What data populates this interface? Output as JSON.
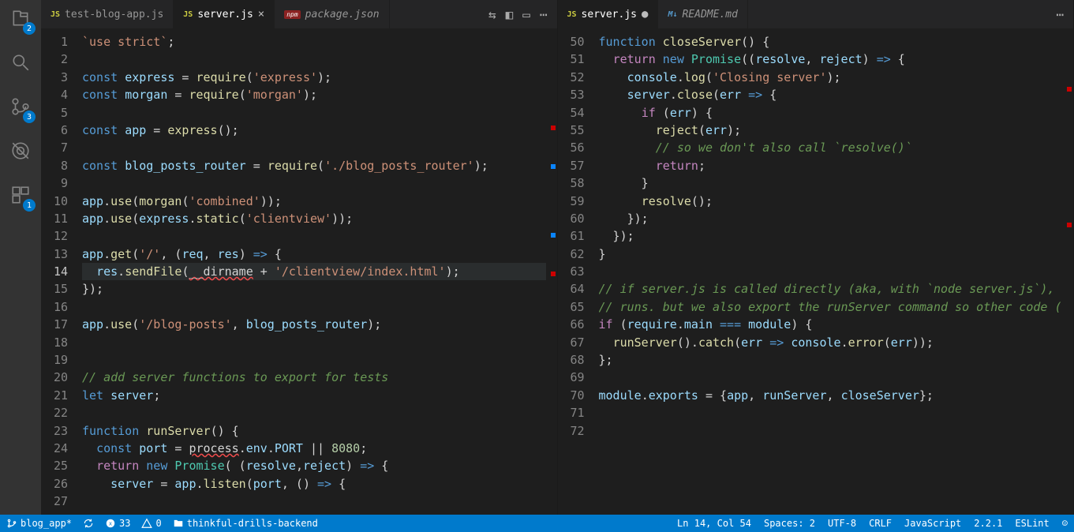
{
  "activity_badges": {
    "explorer": "2",
    "scm": "3",
    "other": "1"
  },
  "left": {
    "tabs": [
      {
        "label": "test-blog-app.js",
        "type": "js",
        "active": false
      },
      {
        "label": "server.js",
        "type": "js",
        "active": true,
        "close": "×"
      },
      {
        "label": "package.json",
        "type": "npm",
        "active": false,
        "italic": true
      }
    ],
    "lines": [
      [
        1,
        [
          [
            "str",
            "`use strict`"
          ],
          [
            "punc",
            ";"
          ]
        ]
      ],
      [
        2,
        []
      ],
      [
        3,
        [
          [
            "kw2",
            "const"
          ],
          [
            "punc",
            " "
          ],
          [
            "var",
            "express"
          ],
          [
            "punc",
            " = "
          ],
          [
            "fn",
            "require"
          ],
          [
            "punc",
            "("
          ],
          [
            "str",
            "'express'"
          ],
          [
            "punc",
            ");"
          ]
        ]
      ],
      [
        4,
        [
          [
            "kw2",
            "const"
          ],
          [
            "punc",
            " "
          ],
          [
            "var",
            "morgan"
          ],
          [
            "punc",
            " = "
          ],
          [
            "fn",
            "require"
          ],
          [
            "punc",
            "("
          ],
          [
            "str",
            "'morgan'"
          ],
          [
            "punc",
            ");"
          ]
        ]
      ],
      [
        5,
        []
      ],
      [
        6,
        [
          [
            "kw2",
            "const"
          ],
          [
            "punc",
            " "
          ],
          [
            "var",
            "app"
          ],
          [
            "punc",
            " = "
          ],
          [
            "fn",
            "express"
          ],
          [
            "punc",
            "();"
          ]
        ]
      ],
      [
        7,
        []
      ],
      [
        8,
        [
          [
            "kw2",
            "const"
          ],
          [
            "punc",
            " "
          ],
          [
            "var",
            "blog_posts_router"
          ],
          [
            "punc",
            " = "
          ],
          [
            "fn",
            "require"
          ],
          [
            "punc",
            "("
          ],
          [
            "str",
            "'./blog_posts_router'"
          ],
          [
            "punc",
            ");"
          ]
        ]
      ],
      [
        9,
        []
      ],
      [
        10,
        [
          [
            "var",
            "app"
          ],
          [
            "punc",
            "."
          ],
          [
            "fn",
            "use"
          ],
          [
            "punc",
            "("
          ],
          [
            "fn",
            "morgan"
          ],
          [
            "punc",
            "("
          ],
          [
            "str",
            "'combined'"
          ],
          [
            "punc",
            "));"
          ]
        ]
      ],
      [
        11,
        [
          [
            "var",
            "app"
          ],
          [
            "punc",
            "."
          ],
          [
            "fn",
            "use"
          ],
          [
            "punc",
            "("
          ],
          [
            "var",
            "express"
          ],
          [
            "punc",
            "."
          ],
          [
            "fn",
            "static"
          ],
          [
            "punc",
            "("
          ],
          [
            "str",
            "'clientview'"
          ],
          [
            "punc",
            "));"
          ]
        ]
      ],
      [
        12,
        []
      ],
      [
        13,
        [
          [
            "var",
            "app"
          ],
          [
            "punc",
            "."
          ],
          [
            "fn",
            "get"
          ],
          [
            "punc",
            "("
          ],
          [
            "str",
            "'/'"
          ],
          [
            "punc",
            ", ("
          ],
          [
            "var",
            "req"
          ],
          [
            "punc",
            ", "
          ],
          [
            "var",
            "res"
          ],
          [
            "punc",
            ") "
          ],
          [
            "kw2",
            "=>"
          ],
          [
            "punc",
            " {"
          ]
        ]
      ],
      [
        14,
        [
          [
            "punc",
            "  "
          ],
          [
            "var",
            "res"
          ],
          [
            "punc",
            "."
          ],
          [
            "fn",
            "sendFile"
          ],
          [
            "punc",
            "("
          ],
          [
            "err",
            "__dirname"
          ],
          [
            "punc",
            " + "
          ],
          [
            "str",
            "'/clientview/index.html'"
          ],
          [
            "punc",
            ");"
          ]
        ],
        "current"
      ],
      [
        15,
        [
          [
            "punc",
            "});"
          ]
        ]
      ],
      [
        16,
        []
      ],
      [
        17,
        [
          [
            "var",
            "app"
          ],
          [
            "punc",
            "."
          ],
          [
            "fn",
            "use"
          ],
          [
            "punc",
            "("
          ],
          [
            "str",
            "'/blog-posts'"
          ],
          [
            "punc",
            ", "
          ],
          [
            "var",
            "blog_posts_router"
          ],
          [
            "punc",
            ");"
          ]
        ]
      ],
      [
        18,
        []
      ],
      [
        19,
        []
      ],
      [
        20,
        [
          [
            "cmt",
            "// add server functions to export for tests"
          ]
        ]
      ],
      [
        21,
        [
          [
            "kw2",
            "let"
          ],
          [
            "punc",
            " "
          ],
          [
            "var",
            "server"
          ],
          [
            "punc",
            ";"
          ]
        ]
      ],
      [
        22,
        []
      ],
      [
        23,
        [
          [
            "kw2",
            "function"
          ],
          [
            "punc",
            " "
          ],
          [
            "fn",
            "runServer"
          ],
          [
            "punc",
            "() {"
          ]
        ]
      ],
      [
        24,
        [
          [
            "punc",
            "  "
          ],
          [
            "kw2",
            "const"
          ],
          [
            "punc",
            " "
          ],
          [
            "var",
            "port"
          ],
          [
            "punc",
            " = "
          ],
          [
            "err",
            "process"
          ],
          [
            "punc",
            "."
          ],
          [
            "var",
            "env"
          ],
          [
            "punc",
            "."
          ],
          [
            "var",
            "PORT"
          ],
          [
            "punc",
            " || "
          ],
          [
            "num",
            "8080"
          ],
          [
            "punc",
            ";"
          ]
        ]
      ],
      [
        25,
        [
          [
            "punc",
            "  "
          ],
          [
            "kw",
            "return"
          ],
          [
            "punc",
            " "
          ],
          [
            "kw2",
            "new"
          ],
          [
            "punc",
            " "
          ],
          [
            "type",
            "Promise"
          ],
          [
            "punc",
            "( ("
          ],
          [
            "var",
            "resolve"
          ],
          [
            "punc",
            ","
          ],
          [
            "var",
            "reject"
          ],
          [
            "punc",
            ") "
          ],
          [
            "kw2",
            "=>"
          ],
          [
            "punc",
            " {"
          ]
        ]
      ],
      [
        26,
        [
          [
            "punc",
            "    "
          ],
          [
            "var",
            "server"
          ],
          [
            "punc",
            " = "
          ],
          [
            "var",
            "app"
          ],
          [
            "punc",
            "."
          ],
          [
            "fn",
            "listen"
          ],
          [
            "punc",
            "("
          ],
          [
            "var",
            "port"
          ],
          [
            "punc",
            ", () "
          ],
          [
            "kw2",
            "=>"
          ],
          [
            "punc",
            " {"
          ]
        ]
      ],
      [
        27,
        []
      ]
    ]
  },
  "right": {
    "tabs": [
      {
        "label": "server.js",
        "type": "js",
        "active": true,
        "dirty": "●"
      },
      {
        "label": "README.md",
        "type": "md",
        "active": false,
        "italic": true
      }
    ],
    "lines": [
      [
        50,
        [
          [
            "kw2",
            "function"
          ],
          [
            "punc",
            " "
          ],
          [
            "fn",
            "closeServer"
          ],
          [
            "punc",
            "() {"
          ]
        ]
      ],
      [
        51,
        [
          [
            "punc",
            "  "
          ],
          [
            "kw",
            "return"
          ],
          [
            "punc",
            " "
          ],
          [
            "kw2",
            "new"
          ],
          [
            "punc",
            " "
          ],
          [
            "type",
            "Promise"
          ],
          [
            "punc",
            "(("
          ],
          [
            "var",
            "resolve"
          ],
          [
            "punc",
            ", "
          ],
          [
            "var",
            "reject"
          ],
          [
            "punc",
            ") "
          ],
          [
            "kw2",
            "=>"
          ],
          [
            "punc",
            " {"
          ]
        ]
      ],
      [
        52,
        [
          [
            "punc",
            "    "
          ],
          [
            "var",
            "console"
          ],
          [
            "punc",
            "."
          ],
          [
            "fn",
            "log"
          ],
          [
            "punc",
            "("
          ],
          [
            "str",
            "'Closing server'"
          ],
          [
            "punc",
            ");"
          ]
        ]
      ],
      [
        53,
        [
          [
            "punc",
            "    "
          ],
          [
            "var",
            "server"
          ],
          [
            "punc",
            "."
          ],
          [
            "fn",
            "close"
          ],
          [
            "punc",
            "("
          ],
          [
            "var",
            "err"
          ],
          [
            "punc",
            " "
          ],
          [
            "kw2",
            "=>"
          ],
          [
            "punc",
            " {"
          ]
        ]
      ],
      [
        54,
        [
          [
            "punc",
            "      "
          ],
          [
            "kw",
            "if"
          ],
          [
            "punc",
            " ("
          ],
          [
            "var",
            "err"
          ],
          [
            "punc",
            ") {"
          ]
        ]
      ],
      [
        55,
        [
          [
            "punc",
            "        "
          ],
          [
            "fn",
            "reject"
          ],
          [
            "punc",
            "("
          ],
          [
            "var",
            "err"
          ],
          [
            "punc",
            ");"
          ]
        ]
      ],
      [
        56,
        [
          [
            "punc",
            "        "
          ],
          [
            "cmt",
            "// so we don't also call `resolve()`"
          ]
        ]
      ],
      [
        57,
        [
          [
            "punc",
            "        "
          ],
          [
            "kw",
            "return"
          ],
          [
            "punc",
            ";"
          ]
        ]
      ],
      [
        58,
        [
          [
            "punc",
            "      }"
          ]
        ]
      ],
      [
        59,
        [
          [
            "punc",
            "      "
          ],
          [
            "fn",
            "resolve"
          ],
          [
            "punc",
            "();"
          ]
        ]
      ],
      [
        60,
        [
          [
            "punc",
            "    });"
          ]
        ]
      ],
      [
        61,
        [
          [
            "punc",
            "  });"
          ]
        ]
      ],
      [
        62,
        [
          [
            "punc",
            "}"
          ]
        ]
      ],
      [
        63,
        []
      ],
      [
        64,
        [
          [
            "cmt",
            "// if server.js is called directly (aka, with `node server.js`), this block"
          ]
        ]
      ],
      [
        65,
        [
          [
            "cmt",
            "// runs. but we also export the runServer command so other code (for instance, test code) can start the server as needed."
          ]
        ]
      ],
      [
        66,
        [
          [
            "kw",
            "if"
          ],
          [
            "punc",
            " ("
          ],
          [
            "var",
            "require"
          ],
          [
            "punc",
            "."
          ],
          [
            "var",
            "main"
          ],
          [
            "punc",
            " "
          ],
          [
            "kw2",
            "==="
          ],
          [
            "punc",
            " "
          ],
          [
            "var",
            "module"
          ],
          [
            "punc",
            ") {"
          ]
        ]
      ],
      [
        67,
        [
          [
            "punc",
            "  "
          ],
          [
            "fn",
            "runServer"
          ],
          [
            "punc",
            "()."
          ],
          [
            "fn",
            "catch"
          ],
          [
            "punc",
            "("
          ],
          [
            "var",
            "err"
          ],
          [
            "punc",
            " "
          ],
          [
            "kw2",
            "=>"
          ],
          [
            "punc",
            " "
          ],
          [
            "var",
            "console"
          ],
          [
            "punc",
            "."
          ],
          [
            "fn",
            "error"
          ],
          [
            "punc",
            "("
          ],
          [
            "var",
            "err"
          ],
          [
            "punc",
            "));"
          ]
        ]
      ],
      [
        68,
        [
          [
            "punc",
            "};"
          ]
        ]
      ],
      [
        69,
        []
      ],
      [
        70,
        [
          [
            "var",
            "module"
          ],
          [
            "punc",
            "."
          ],
          [
            "var",
            "exports"
          ],
          [
            "punc",
            " = {"
          ],
          [
            "var",
            "app"
          ],
          [
            "punc",
            ", "
          ],
          [
            "var",
            "runServer"
          ],
          [
            "punc",
            ", "
          ],
          [
            "var",
            "closeServer"
          ],
          [
            "punc",
            "};"
          ]
        ]
      ],
      [
        71,
        []
      ],
      [
        72,
        []
      ]
    ]
  },
  "status": {
    "branch": "blog_app*",
    "errors": "33",
    "warnings": "0",
    "folder": "thinkful-drills-backend",
    "cursor": "Ln 14, Col 54",
    "spaces": "Spaces: 2",
    "encoding": "UTF-8",
    "eol": "CRLF",
    "language": "JavaScript",
    "ext_version": "2.2.1",
    "linter": "ESLint"
  }
}
